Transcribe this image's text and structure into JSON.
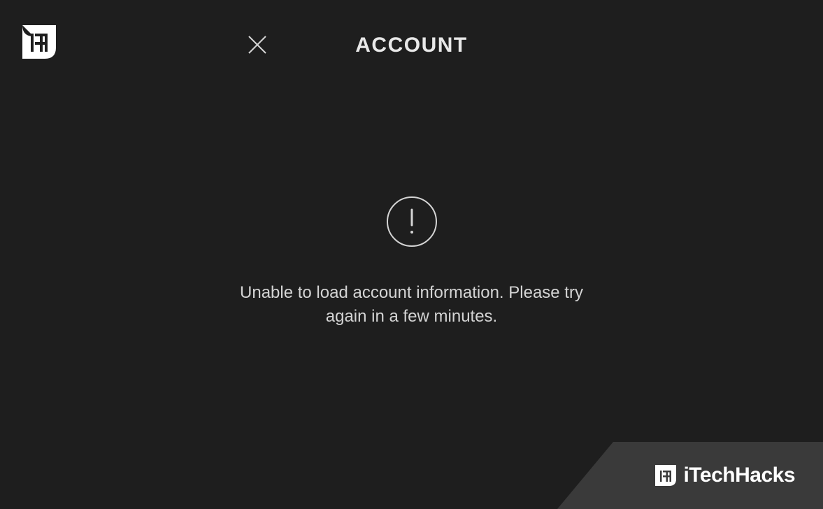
{
  "header": {
    "title": "ACCOUNT"
  },
  "error": {
    "message": "Unable to load account information. Please try again in a few minutes."
  },
  "watermark": {
    "text": "iTechHacks"
  }
}
